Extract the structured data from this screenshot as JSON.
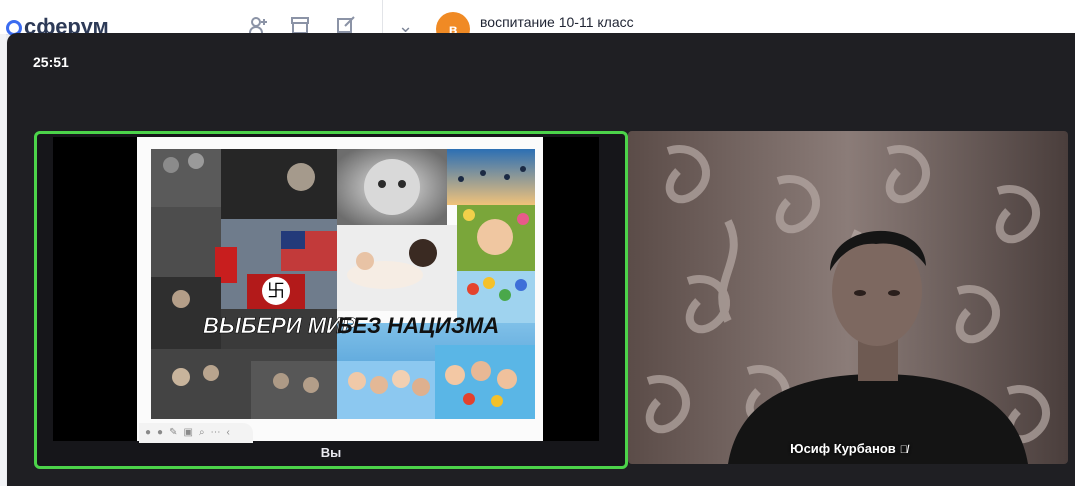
{
  "app": {
    "logo_text": "сферум",
    "chat_title": "воспитание 10-11 класс",
    "chat_avatar_letter": "в"
  },
  "call": {
    "timer": "25:51",
    "self_tile": {
      "label": "Вы",
      "slide_caption_left": "ВЫБЕРИ МИР",
      "slide_caption_right": "БЕЗ НАЦИЗМА"
    },
    "remote_tile": {
      "name": "Юсиф Курбанов"
    }
  },
  "colors": {
    "speaking_border": "#4cd34a",
    "call_background": "#1f1f23",
    "logo_accent": "#3b6cf0",
    "avatar_bg": "#f08a24"
  },
  "icons": [
    "add-user-icon",
    "archive-icon",
    "edit-icon",
    "chevron-down-icon",
    "mic-off-icon"
  ]
}
